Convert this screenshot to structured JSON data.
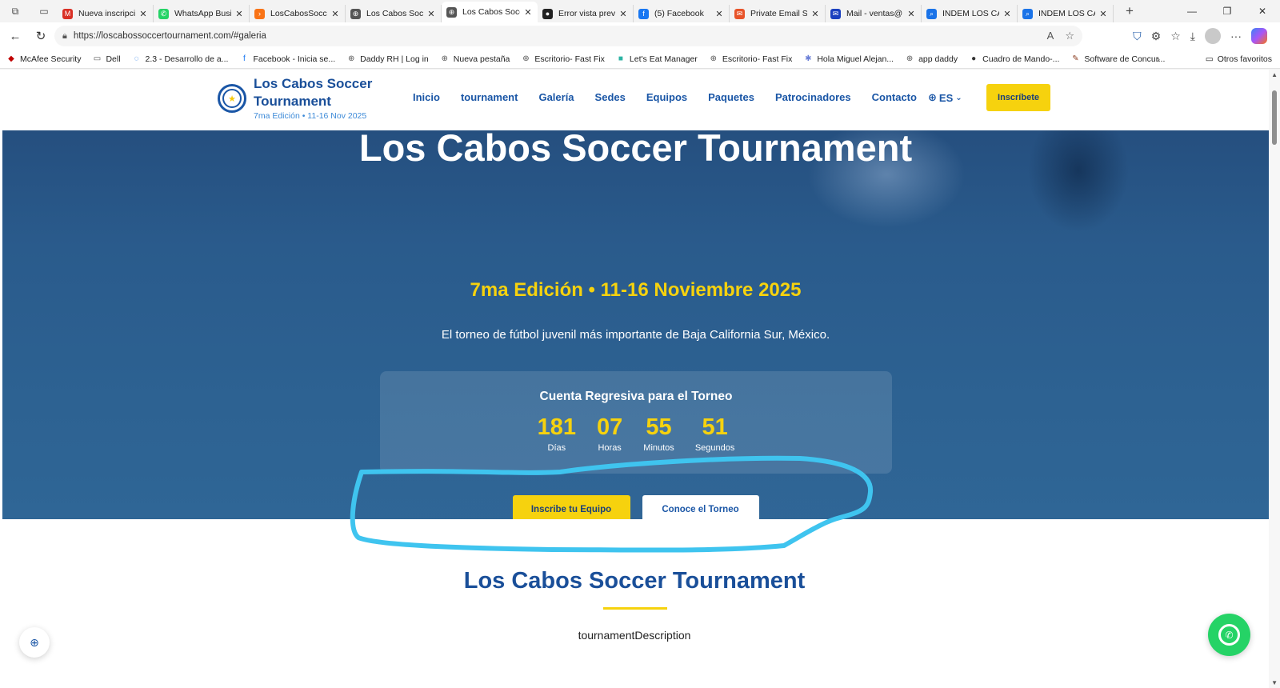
{
  "browser": {
    "tabs": [
      {
        "label": "Nueva inscripción",
        "favicon": "gmail-icon",
        "color": "#d93025"
      },
      {
        "label": "WhatsApp Business",
        "favicon": "whatsapp-icon",
        "color": "#25d366"
      },
      {
        "label": "LosCabosSoccer",
        "favicon": "orange-icon",
        "color": "#f97316"
      },
      {
        "label": "Los Cabos Soccer",
        "favicon": "globe-icon",
        "color": "#555555"
      },
      {
        "label": "Los Cabos Soccer",
        "favicon": "globe-icon",
        "color": "#555555",
        "active": true
      },
      {
        "label": "Error vista previa",
        "favicon": "github-icon",
        "color": "#222222"
      },
      {
        "label": "(5) Facebook",
        "favicon": "facebook-icon",
        "color": "#1877f2"
      },
      {
        "label": "Private Email Su",
        "favicon": "email-icon",
        "color": "#e8542a"
      },
      {
        "label": "Mail - ventas@",
        "favicon": "mail-icon",
        "color": "#1a3fbf"
      },
      {
        "label": "INDEM LOS CAB",
        "favicon": "search-icon",
        "color": "#1a73e8"
      },
      {
        "label": "INDEM LOS CAB",
        "favicon": "search-icon",
        "color": "#1a73e8"
      }
    ],
    "url": "https://loscabossoccertournament.com/#galeria",
    "favorites": [
      {
        "label": "McAfee Security",
        "icon": "mcafee-icon",
        "color": "#c00000"
      },
      {
        "label": "Dell",
        "icon": "folder-icon",
        "color": "#555555"
      },
      {
        "label": "2.3 - Desarrollo de a...",
        "icon": "loading-icon",
        "color": "#1a73e8"
      },
      {
        "label": "Facebook - Inicia se...",
        "icon": "facebook-icon",
        "color": "#1877f2"
      },
      {
        "label": "Daddy RH | Log in",
        "icon": "globe-icon",
        "color": "#555555"
      },
      {
        "label": "Nueva pestaña",
        "icon": "globe-icon",
        "color": "#555555"
      },
      {
        "label": "Escritorio- Fast Fix",
        "icon": "globe-icon",
        "color": "#555555"
      },
      {
        "label": "Let's Eat Manager",
        "icon": "app-icon",
        "color": "#2bb3a3"
      },
      {
        "label": "Escritorio- Fast Fix",
        "icon": "globe-icon",
        "color": "#555555"
      },
      {
        "label": "Hola Miguel Alejan...",
        "icon": "puzzle-icon",
        "color": "#6b7fd7"
      },
      {
        "label": "app daddy",
        "icon": "globe-icon",
        "color": "#555555"
      },
      {
        "label": "Cuadro de Mando-...",
        "icon": "ball-icon",
        "color": "#333333"
      },
      {
        "label": "Software de Concur...",
        "icon": "pencil-icon",
        "color": "#8a3b1e"
      }
    ],
    "other_favorites": "Otros favoritos"
  },
  "site": {
    "brand_title": "Los Cabos Soccer Tournament",
    "brand_sub": "7ma Edición • 11-16 Nov 2025",
    "nav": [
      "Inicio",
      "tournament",
      "Galería",
      "Sedes",
      "Equipos",
      "Paquetes",
      "Patrocinadores",
      "Contacto"
    ],
    "lang": "ES",
    "cta_top": "Inscríbete",
    "hero": {
      "title": "Los Cabos Soccer Tournament",
      "edition": "7ma Edición • 11-16 Noviembre 2025",
      "description": "El torneo de fútbol juvenil más importante de Baja California Sur, México.",
      "countdown_title": "Cuenta Regresiva para el Torneo",
      "countdown": [
        {
          "value": "181",
          "label": "Días"
        },
        {
          "value": "07",
          "label": "Horas"
        },
        {
          "value": "55",
          "label": "Minutos"
        },
        {
          "value": "51",
          "label": "Segundos"
        }
      ],
      "btn_primary": "Inscribe tu Equipo",
      "btn_secondary": "Conoce el Torneo"
    },
    "section": {
      "title": "Los Cabos Soccer Tournament",
      "description": "tournamentDescription"
    }
  },
  "colors": {
    "brand_blue": "#1a56a6",
    "accent_yellow": "#f6d20e",
    "annotation": "#3fc4ef",
    "whatsapp": "#25d366"
  }
}
